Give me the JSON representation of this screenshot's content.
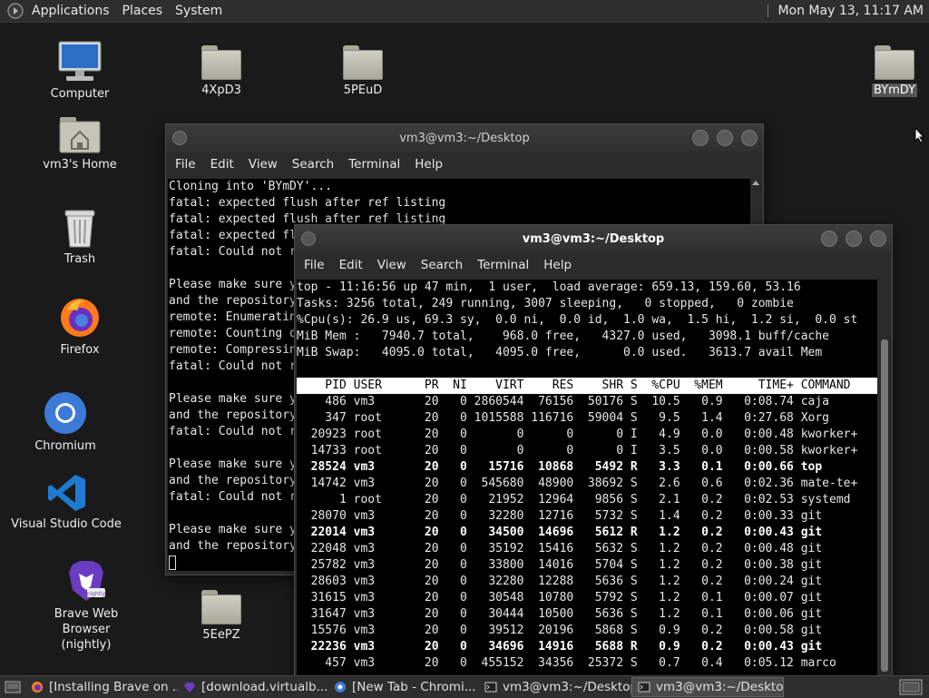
{
  "top_panel": {
    "menus": [
      "Applications",
      "Places",
      "System"
    ],
    "clock": "Mon May 13, 11:17 AM"
  },
  "desktop_icons": {
    "computer": "Computer",
    "home": "vm3's Home",
    "trash": "Trash",
    "firefox": "Firefox",
    "chromium": "Chromium",
    "vscode": "Visual Studio Code",
    "brave": "Brave Web Browser\n(nightly)",
    "brave_badge": "nightly",
    "folders": [
      "4XpD3",
      "5PEuD",
      "5EePZ"
    ],
    "folder_right": "BYmDY"
  },
  "window_back": {
    "title": "vm3@vm3:~/Desktop",
    "menus": [
      "File",
      "Edit",
      "View",
      "Search",
      "Terminal",
      "Help"
    ],
    "lines": [
      "Cloning into 'BYmDY'...",
      "fatal: expected flush after ref listing",
      "fatal: expected flush after ref listing",
      "fatal: expected fl",
      "fatal: Could not r",
      "",
      "Please make sure y",
      "and the repository",
      "remote: Enumeratin",
      "remote: Counting o",
      "remote: Compressin",
      "fatal: Could not r",
      "",
      "Please make sure y",
      "and the repository",
      "fatal: Could not r",
      "",
      "Please make sure y",
      "and the repository",
      "fatal: Could not r",
      "",
      "Please make sure y",
      "and the repository"
    ]
  },
  "window_front": {
    "title": "vm3@vm3:~/Desktop",
    "menus": [
      "File",
      "Edit",
      "View",
      "Search",
      "Terminal",
      "Help"
    ],
    "summary": [
      "top - 11:16:56 up 47 min,  1 user,  load average: 659.13, 159.60, 53.16",
      "Tasks: 3256 total, 249 running, 3007 sleeping,   0 stopped,   0 zombie",
      "%Cpu(s): 26.9 us, 69.3 sy,  0.0 ni,  0.0 id,  1.0 wa,  1.5 hi,  1.2 si,  0.0 st",
      "MiB Mem :   7940.7 total,    968.0 free,   4327.0 used,   3098.1 buff/cache",
      "MiB Swap:   4095.0 total,   4095.0 free,      0.0 used.   3613.7 avail Mem"
    ],
    "header": "    PID USER      PR  NI    VIRT    RES    SHR S  %CPU  %MEM     TIME+ COMMAND",
    "rows": [
      {
        "text": "    486 vm3       20   0 2860544  76156  50176 S  10.5   0.9   0:08.74 caja",
        "bold": false
      },
      {
        "text": "    347 root      20   0 1015588 116716  59004 S   9.5   1.4   0:27.68 Xorg",
        "bold": false
      },
      {
        "text": "  20923 root      20   0       0      0      0 I   4.9   0.0   0:00.48 kworker+",
        "bold": false
      },
      {
        "text": "  14733 root      20   0       0      0      0 I   3.5   0.0   0:00.58 kworker+",
        "bold": false
      },
      {
        "text": "  28524 vm3       20   0   15716  10868   5492 R   3.3   0.1   0:00.66 top",
        "bold": true
      },
      {
        "text": "  14742 vm3       20   0  545680  48900  38692 S   2.6   0.6   0:02.36 mate-te+",
        "bold": false
      },
      {
        "text": "      1 root      20   0   21952  12964   9856 S   2.1   0.2   0:02.53 systemd",
        "bold": false
      },
      {
        "text": "  28070 vm3       20   0   32280  12716   5732 S   1.4   0.2   0:00.33 git",
        "bold": false
      },
      {
        "text": "  22014 vm3       20   0   34500  14696   5612 R   1.2   0.2   0:00.43 git",
        "bold": true
      },
      {
        "text": "  22048 vm3       20   0   35192  15416   5632 S   1.2   0.2   0:00.48 git",
        "bold": false
      },
      {
        "text": "  25782 vm3       20   0   33800  14016   5704 S   1.2   0.2   0:00.38 git",
        "bold": false
      },
      {
        "text": "  28603 vm3       20   0   32280  12288   5636 S   1.2   0.2   0:00.24 git",
        "bold": false
      },
      {
        "text": "  31615 vm3       20   0   30548  10780   5792 S   1.2   0.1   0:00.07 git",
        "bold": false
      },
      {
        "text": "  31647 vm3       20   0   30444  10500   5636 S   1.2   0.1   0:00.06 git",
        "bold": false
      },
      {
        "text": "  15576 vm3       20   0   39512  20196   5868 S   0.9   0.2   0:00.58 git",
        "bold": false
      },
      {
        "text": "  22236 vm3       20   0   34696  14916   5688 R   0.9   0.2   0:00.43 git",
        "bold": true
      },
      {
        "text": "    457 vm3       20   0  455152  34356  25372 S   0.7   0.4   0:05.12 marco",
        "bold": false
      }
    ]
  },
  "taskbar": {
    "items": [
      "[Installing Brave on ...",
      "[download.virtualb...",
      "[New Tab - Chromi...",
      "vm3@vm3:~/Desktop",
      "vm3@vm3:~/Desktop"
    ]
  },
  "colors": {
    "desktop_bg": "#1a1a1a",
    "panel_bg": "#2e2e2e",
    "terminal_bg": "#000000",
    "vscode_blue": "#1f7ad1",
    "firefox_orange": "#ff7a1a",
    "brave_purple": "#6a3cc2"
  }
}
